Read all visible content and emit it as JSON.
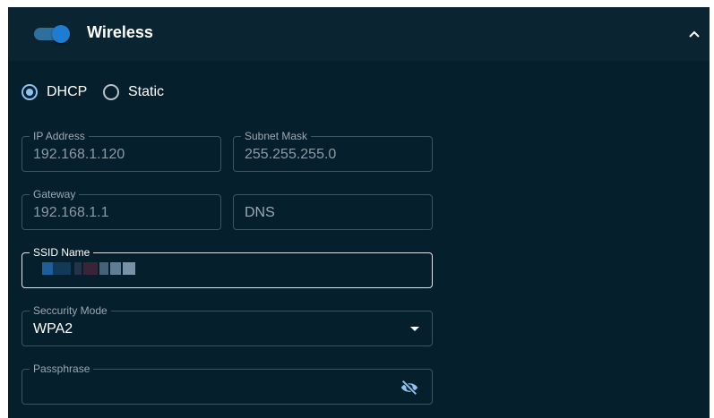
{
  "section": {
    "title": "Wireless",
    "enabled": true,
    "expanded": true,
    "collapse_icon": "chevron-up-icon"
  },
  "ip_mode": {
    "options": [
      "DHCP",
      "Static"
    ],
    "selected": "DHCP"
  },
  "fields": {
    "ip_address": {
      "label": "IP Address",
      "value": "192.168.1.120"
    },
    "subnet_mask": {
      "label": "Subnet Mask",
      "value": "255.255.255.0"
    },
    "gateway": {
      "label": "Gateway",
      "value": "192.168.1.1"
    },
    "dns": {
      "label": "",
      "placeholder": "DNS"
    },
    "ssid": {
      "label": "SSID Name"
    },
    "security_mode": {
      "label": "Seccurity Mode",
      "value": "WPA2"
    },
    "passphrase": {
      "label": "Passphrase",
      "value": "",
      "visibility_icon": "eye-off-icon"
    }
  },
  "colors": {
    "panel_bg": "#061f2d",
    "header_bg": "#0a2431",
    "accent": "#1f7cd3",
    "radio_selected": "#8fc2f0"
  }
}
